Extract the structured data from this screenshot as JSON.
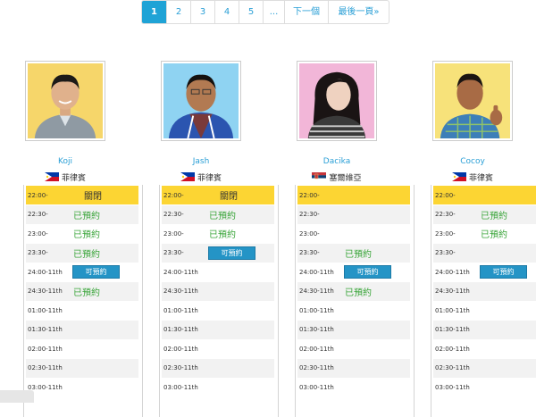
{
  "pagination": {
    "pages": [
      "1",
      "2",
      "3",
      "4",
      "5",
      "..."
    ],
    "next_label": "下一個",
    "last_label": "最後一頁»"
  },
  "labels": {
    "closed": "關閉",
    "booked": "已預約",
    "available": "可預約"
  },
  "teachers": [
    {
      "name": "Koji",
      "country": "菲律賓",
      "flag": "philippines-flag",
      "slots": [
        {
          "time": "22:00-",
          "status": "closed"
        },
        {
          "time": "22:30-",
          "status": "booked"
        },
        {
          "time": "23:00-",
          "status": "booked"
        },
        {
          "time": "23:30-",
          "status": "booked"
        },
        {
          "time": "24:00-11th",
          "status": "available"
        },
        {
          "time": "24:30-11th",
          "status": "booked"
        },
        {
          "time": "01:00-11th",
          "status": ""
        },
        {
          "time": "01:30-11th",
          "status": ""
        },
        {
          "time": "02:00-11th",
          "status": ""
        },
        {
          "time": "02:30-11th",
          "status": ""
        },
        {
          "time": "03:00-11th",
          "status": ""
        }
      ]
    },
    {
      "name": "Jash",
      "country": "菲律賓",
      "flag": "philippines-flag",
      "slots": [
        {
          "time": "22:00-",
          "status": "closed"
        },
        {
          "time": "22:30-",
          "status": "booked"
        },
        {
          "time": "23:00-",
          "status": "booked"
        },
        {
          "time": "23:30-",
          "status": "available"
        },
        {
          "time": "24:00-11th",
          "status": ""
        },
        {
          "time": "24:30-11th",
          "status": ""
        },
        {
          "time": "01:00-11th",
          "status": ""
        },
        {
          "time": "01:30-11th",
          "status": ""
        },
        {
          "time": "02:00-11th",
          "status": ""
        },
        {
          "time": "02:30-11th",
          "status": ""
        },
        {
          "time": "03:00-11th",
          "status": ""
        }
      ]
    },
    {
      "name": "Dacika",
      "country": "塞爾維亞",
      "flag": "serbia-flag",
      "slots": [
        {
          "time": "22:00-",
          "status": "closed-empty"
        },
        {
          "time": "22:30-",
          "status": ""
        },
        {
          "time": "23:00-",
          "status": ""
        },
        {
          "time": "23:30-",
          "status": "booked"
        },
        {
          "time": "24:00-11th",
          "status": "available"
        },
        {
          "time": "24:30-11th",
          "status": "booked"
        },
        {
          "time": "01:00-11th",
          "status": ""
        },
        {
          "time": "01:30-11th",
          "status": ""
        },
        {
          "time": "02:00-11th",
          "status": ""
        },
        {
          "time": "02:30-11th",
          "status": ""
        },
        {
          "time": "03:00-11th",
          "status": ""
        }
      ]
    },
    {
      "name": "Cocoy",
      "country": "菲律賓",
      "flag": "philippines-flag",
      "slots": [
        {
          "time": "22:00-",
          "status": "closed-empty"
        },
        {
          "time": "22:30-",
          "status": "booked"
        },
        {
          "time": "23:00-",
          "status": "booked"
        },
        {
          "time": "23:30-",
          "status": ""
        },
        {
          "time": "24:00-11th",
          "status": "available"
        },
        {
          "time": "24:30-11th",
          "status": ""
        },
        {
          "time": "01:00-11th",
          "status": ""
        },
        {
          "time": "01:30-11th",
          "status": ""
        },
        {
          "time": "02:00-11th",
          "status": ""
        },
        {
          "time": "02:30-11th",
          "status": ""
        },
        {
          "time": "03:00-11th",
          "status": ""
        }
      ]
    }
  ],
  "colors": {
    "accent": "#2a9fd6",
    "active_page": "#1fa3d6",
    "closed": "#fcd533",
    "booked": "#3aa53a",
    "available_btn": "#2494c6",
    "row_alt": "#f2f2f2"
  }
}
